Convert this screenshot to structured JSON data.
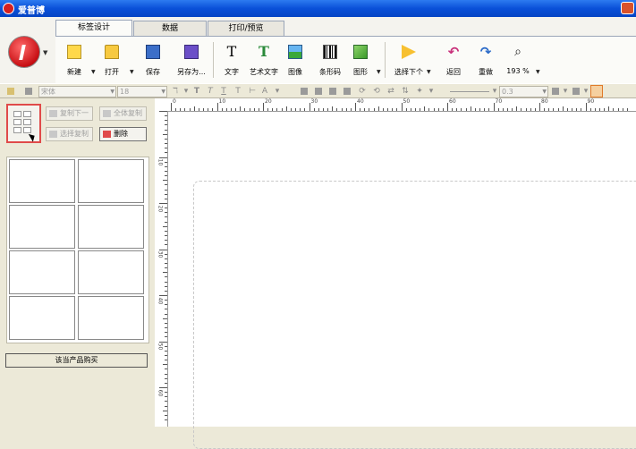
{
  "window": {
    "title": "爱普博"
  },
  "tabs": [
    "标签设计",
    "数据",
    "打印/预览"
  ],
  "ribbon": {
    "new": "新建",
    "open": "打开",
    "save": "保存",
    "save_as": "另存为...",
    "text": "文字",
    "art_text": "艺术文字",
    "image": "图像",
    "barcode": "条形码",
    "shape": "图形",
    "select_next": "选择下个",
    "undo": "返回",
    "redo": "重做",
    "zoom": "193 %"
  },
  "format_toolbar": {
    "font_family": "宋体",
    "font_size": "18",
    "line_width": "0.3"
  },
  "left_panel": {
    "copy_next": "复制下一",
    "copy_all": "全体复制",
    "copy_selected": "选择复制",
    "delete": "删除",
    "buy": "该当产品购买"
  },
  "ruler": {
    "h_ticks": [
      "0",
      "10",
      "20",
      "30",
      "40",
      "50",
      "60",
      "70",
      "80",
      "90"
    ],
    "v_ticks": [
      "10",
      "20",
      "30",
      "40",
      "50",
      "60"
    ]
  }
}
